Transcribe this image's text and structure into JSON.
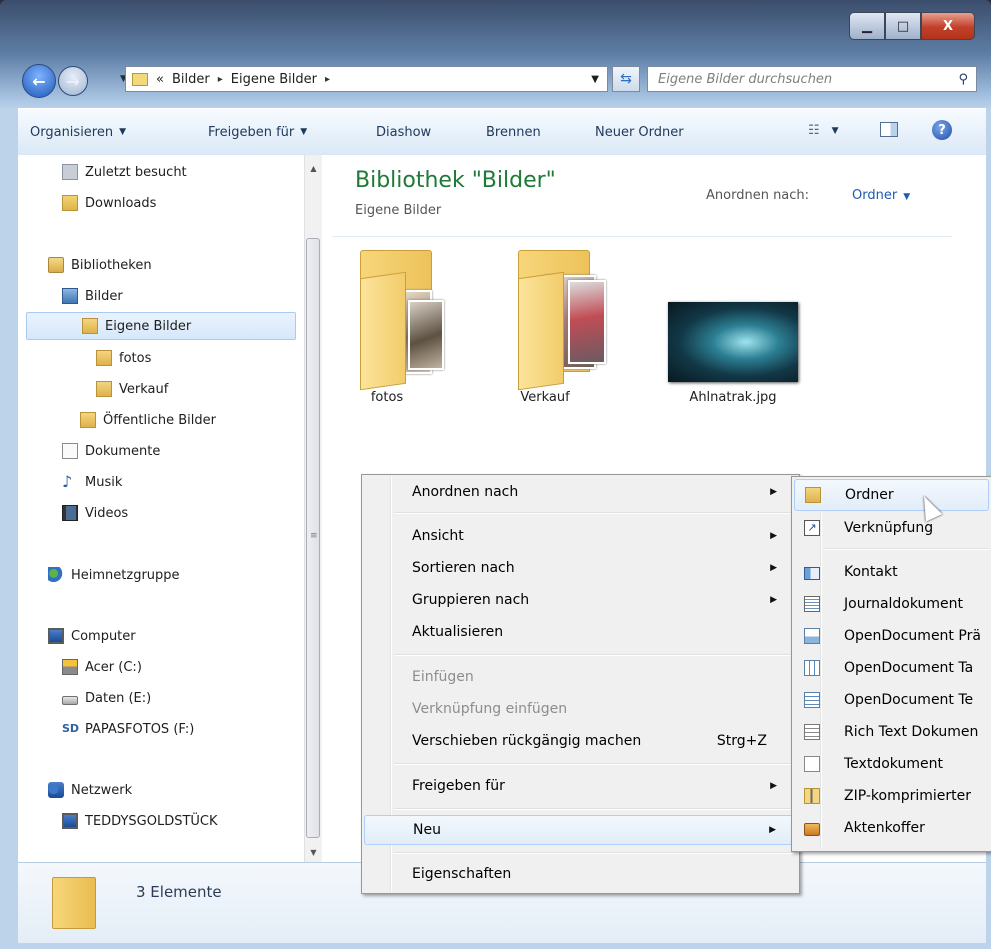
{
  "window": {
    "controls": {
      "minimize": "▁",
      "maximize": "□",
      "close": "X"
    }
  },
  "address": {
    "chevron": "«",
    "crumbs": [
      "Bilder",
      "Eigene Bilder"
    ],
    "arrow": "▸"
  },
  "search": {
    "placeholder": "Eigene Bilder durchsuchen"
  },
  "toolbar": {
    "organize": "Organisieren",
    "share": "Freigeben für",
    "slideshow": "Diashow",
    "burn": "Brennen",
    "new_folder": "Neuer Ordner"
  },
  "sidebar": {
    "items": [
      {
        "label": "Zuletzt besucht"
      },
      {
        "label": "Downloads"
      },
      {
        "label": "Bibliotheken"
      },
      {
        "label": "Bilder"
      },
      {
        "label": "Eigene Bilder"
      },
      {
        "label": "fotos"
      },
      {
        "label": "Verkauf"
      },
      {
        "label": "Öffentliche Bilder"
      },
      {
        "label": "Dokumente"
      },
      {
        "label": "Musik"
      },
      {
        "label": "Videos"
      },
      {
        "label": "Heimnetzgruppe"
      },
      {
        "label": "Computer"
      },
      {
        "label": "Acer (C:)"
      },
      {
        "label": "Daten (E:)"
      },
      {
        "label": "PAPASFOTOS (F:)"
      },
      {
        "label": "Netzwerk"
      },
      {
        "label": "TEDDYSGOLDSTÜCK"
      }
    ]
  },
  "library": {
    "title": "Bibliothek \"Bilder\"",
    "subtitle": "Eigene Bilder",
    "arrange_label": "Anordnen nach:",
    "arrange_value": "Ordner"
  },
  "files": [
    {
      "label": "fotos"
    },
    {
      "label": "Verkauf"
    },
    {
      "label": "Ahlnatrak.jpg"
    }
  ],
  "status": {
    "text": "3 Elemente"
  },
  "context_menu": {
    "items": [
      {
        "label": "Anordnen nach"
      },
      {
        "label": "Ansicht"
      },
      {
        "label": "Sortieren nach"
      },
      {
        "label": "Gruppieren nach"
      },
      {
        "label": "Aktualisieren"
      },
      {
        "label": "Einfügen"
      },
      {
        "label": "Verknüpfung einfügen"
      },
      {
        "label": "Verschieben rückgängig machen",
        "shortcut": "Strg+Z"
      },
      {
        "label": "Freigeben für"
      },
      {
        "label": "Neu"
      },
      {
        "label": "Eigenschaften"
      }
    ]
  },
  "new_submenu": {
    "items": [
      {
        "label": "Ordner"
      },
      {
        "label": "Verknüpfung"
      },
      {
        "label": "Kontakt"
      },
      {
        "label": "Journaldokument"
      },
      {
        "label": "OpenDocument Prä"
      },
      {
        "label": "OpenDocument Ta"
      },
      {
        "label": "OpenDocument Te"
      },
      {
        "label": "Rich Text Dokumen"
      },
      {
        "label": "Textdokument"
      },
      {
        "label": "ZIP-komprimierter"
      },
      {
        "label": "Aktenkoffer"
      }
    ]
  },
  "colors": {
    "accent_green": "#1e7a36",
    "link_blue": "#1e5ab4"
  }
}
